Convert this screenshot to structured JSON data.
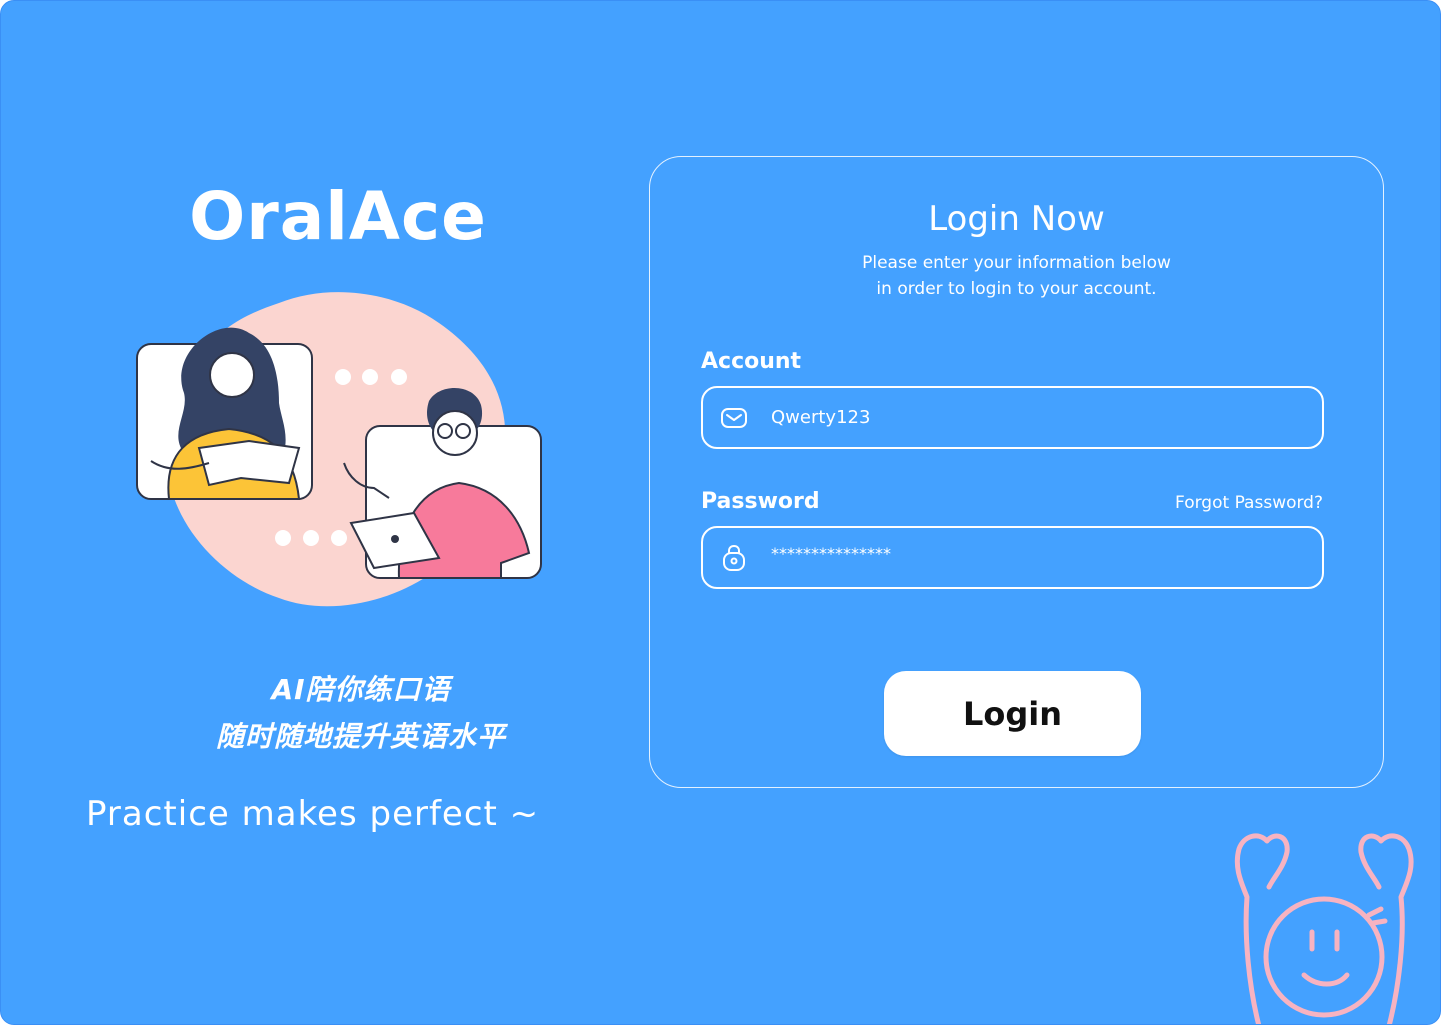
{
  "brand": {
    "name": "OralAce"
  },
  "slogans": {
    "cn_line1": "AI陪你练口语",
    "cn_line2": "随时随地提升英语水平",
    "en": "Practice makes perfect ~"
  },
  "login": {
    "title": "Login Now",
    "subtitle_line1": "Please enter your information below",
    "subtitle_line2": "in order to login to your account.",
    "account_label": "Account",
    "account_value": "Qwerty123",
    "password_label": "Password",
    "password_value": "***************",
    "forgot_password": "Forgot Password?",
    "button_label": "Login"
  },
  "icons": {
    "account": "mail-icon",
    "password": "lock-icon"
  },
  "colors": {
    "background": "#44a1ff",
    "foreground": "#ffffff",
    "accent_pink": "#f7c3c6",
    "button_text": "#111111"
  }
}
